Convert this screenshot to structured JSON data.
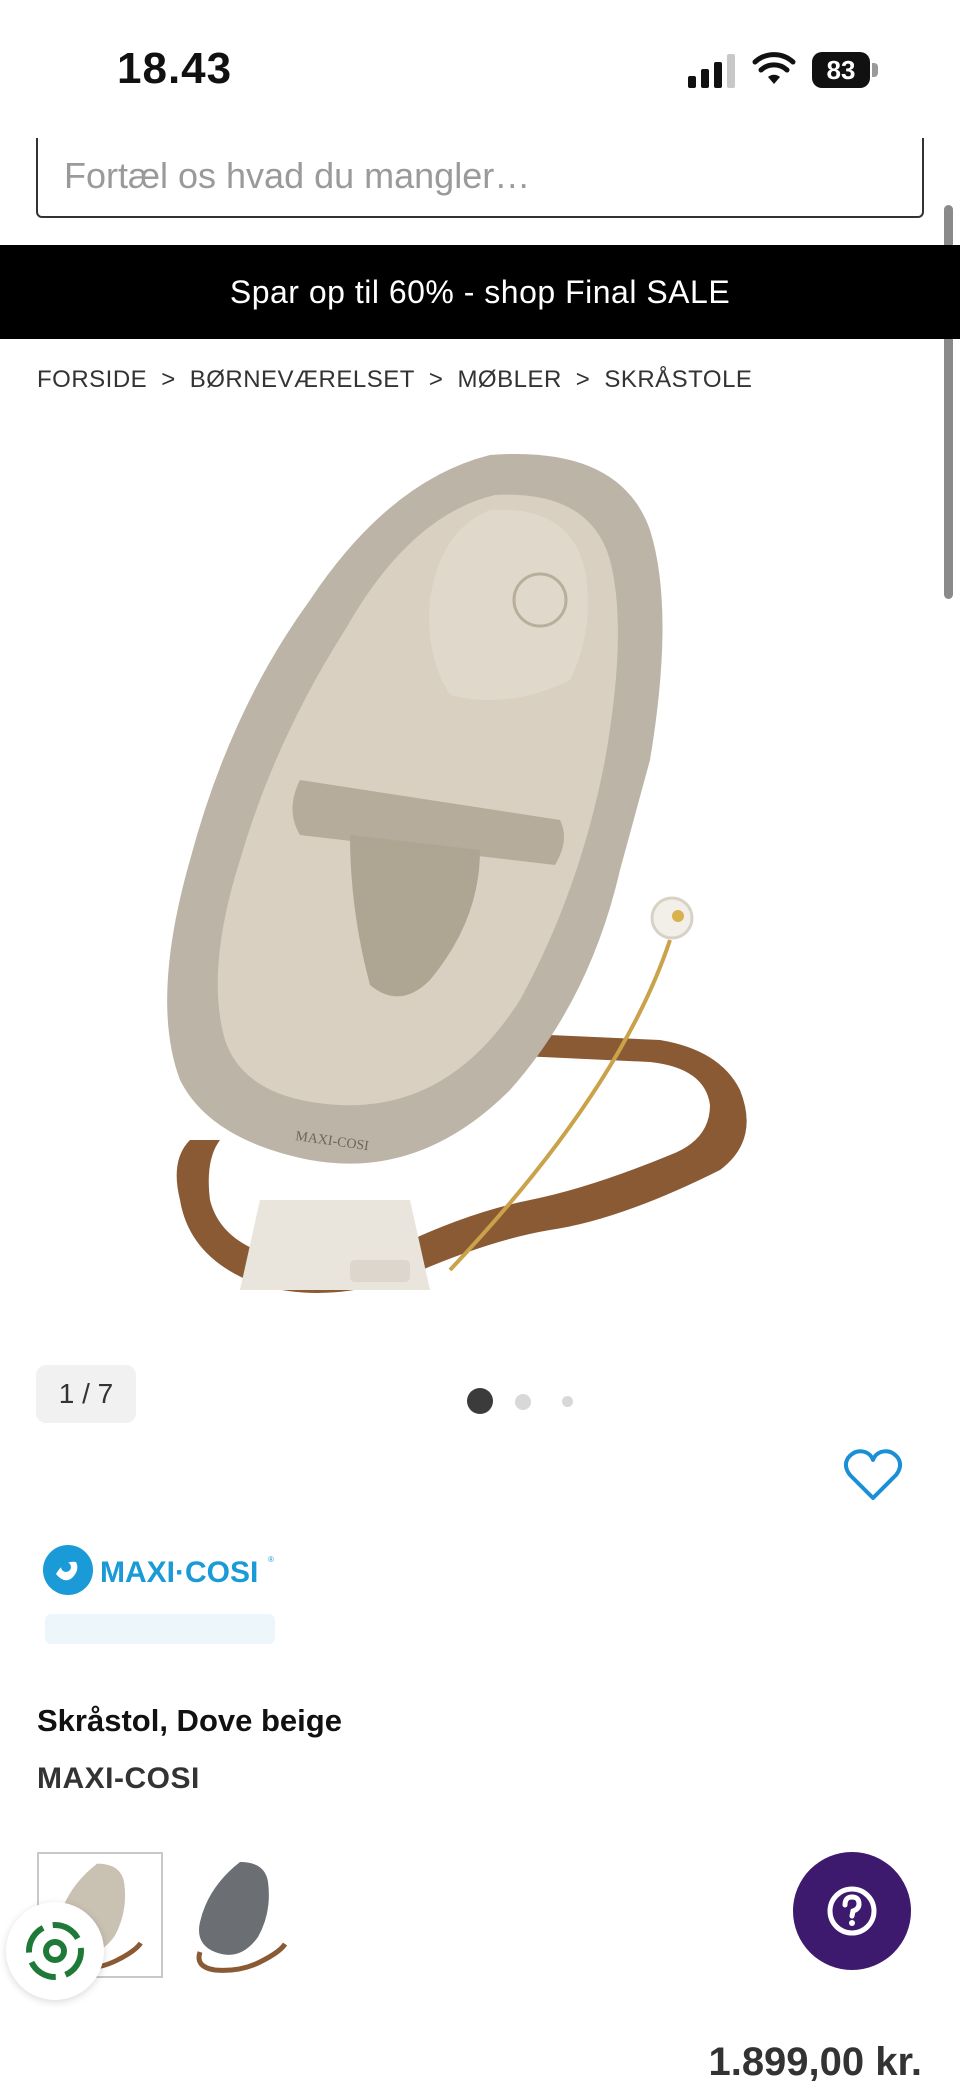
{
  "status_bar": {
    "time": "18.43",
    "battery": "83"
  },
  "search": {
    "placeholder": "Fortæl os hvad du mangler…"
  },
  "promo": {
    "text": "Spar op til 60% - shop Final SALE"
  },
  "breadcrumb": {
    "separator": ">",
    "items": [
      "FORSIDE",
      "BØRNEVÆRELSET",
      "MØBLER",
      "SKRÅSTOLE"
    ]
  },
  "gallery": {
    "counter": "1 / 7",
    "current_index": 1,
    "total": 7
  },
  "brand_logo_text": "MAXI-COSI",
  "product": {
    "title": "Skråstol, Dove beige",
    "brand": "MAXI-COSI",
    "price": "1.899,00 kr."
  },
  "variants": [
    {
      "color": "beige",
      "selected": true
    },
    {
      "color": "grey",
      "selected": false
    }
  ],
  "colors": {
    "promo_bg": "#000000",
    "help_button": "#3d1a6e",
    "brand_blue": "#1a9ad6",
    "wishlist_blue": "#1a8fd6"
  },
  "icons": {
    "signal": "signal-icon",
    "wifi": "wifi-icon",
    "wishlist": "heart-icon",
    "help": "question-icon",
    "recycle": "recycle-icon"
  }
}
